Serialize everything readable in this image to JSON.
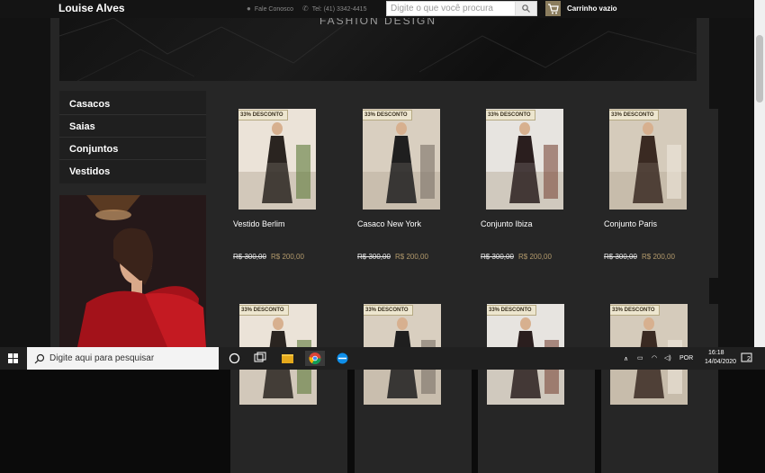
{
  "header": {
    "brand": "Louise Alves",
    "contact_label": "Fale Conosco",
    "phone": "Tel: (41) 3342-4415",
    "search_placeholder": "Digite o que você procura",
    "cart_label": "Carrinho vazio"
  },
  "banner": {
    "text": "FASHION DESIGN"
  },
  "sidebar": {
    "items": [
      {
        "label": "Casacos"
      },
      {
        "label": "Saias"
      },
      {
        "label": "Conjuntos"
      },
      {
        "label": "Vestidos"
      }
    ]
  },
  "products": [
    {
      "badge": "33% DESCONTO",
      "name": "Vestido Berlim",
      "old_price": "R$ 300,00",
      "new_price": "R$ 200,00"
    },
    {
      "badge": "33% DESCONTO",
      "name": "Casaco New York",
      "old_price": "R$ 300,00",
      "new_price": "R$ 200,00"
    },
    {
      "badge": "33% DESCONTO",
      "name": "Conjunto Ibiza",
      "old_price": "R$ 300,00",
      "new_price": "R$ 200,00"
    },
    {
      "badge": "33% DESCONTO",
      "name": "Conjunto Paris",
      "old_price": "R$ 300,00",
      "new_price": "R$ 200,00"
    },
    {
      "badge": "33% DESCONTO"
    },
    {
      "badge": "33% DESCONTO"
    },
    {
      "badge": "33% DESCONTO"
    },
    {
      "badge": "33% DESCONTO"
    }
  ],
  "taskbar": {
    "search_text": "Digite aqui para pesquisar",
    "language": "POR",
    "time": "16:18",
    "date": "14/04/2020",
    "notification_count": "2"
  },
  "colors": {
    "accent": "#b39a6c",
    "cart_box": "#8b7d5e",
    "badge_bg": "#ede6cf"
  }
}
